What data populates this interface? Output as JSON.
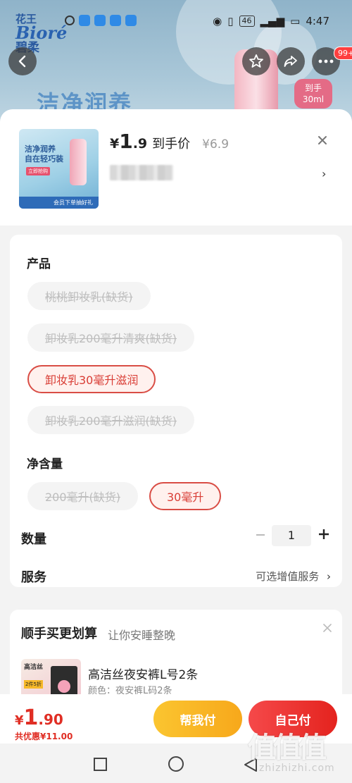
{
  "status_bar": {
    "network": "46",
    "time": "4:47"
  },
  "hero": {
    "brand_cn": "花王",
    "brand_en": "Bioré",
    "brand_cn2": "碧柔",
    "headline": "洁净润养",
    "badge": "到手\n30ml"
  },
  "cart_count": "99+",
  "product": {
    "thumb_title": "洁净润养\n自在轻巧装",
    "thumb_tag": "立即抢购",
    "thumb_footer": "会员下单抽好礼",
    "currency": "¥",
    "price_int": "1",
    "price_dec": ".9",
    "price_label": "到手价",
    "original_price": "¥6.9"
  },
  "options": {
    "product_label": "产品",
    "product_items": [
      {
        "label": "桃桃卸妆乳(缺货)",
        "state": "out_of_stock"
      },
      {
        "label": "卸妆乳200毫升清爽(缺货)",
        "state": "out_of_stock"
      },
      {
        "label": "卸妆乳30毫升滋润",
        "state": "selected"
      },
      {
        "label": "卸妆乳200毫升滋润(缺货)",
        "state": "out_of_stock"
      }
    ],
    "volume_label": "净含量",
    "volume_items": [
      {
        "label": "200毫升(缺货)",
        "state": "out_of_stock"
      },
      {
        "label": "30毫升",
        "state": "selected"
      }
    ]
  },
  "quantity": {
    "label": "数量",
    "value": "1"
  },
  "service": {
    "label": "服务",
    "value": "可选增值服务"
  },
  "recommend": {
    "title": "顺手买更划算",
    "subtitle": "让你安睡整晚",
    "img_logo": "高洁丝",
    "img_badge": "2件5折",
    "item_name": "高洁丝夜安裤L号2条",
    "item_variant": "颜色：夜安裤L码2条"
  },
  "footer": {
    "currency": "¥",
    "total_int": "1",
    "total_dec": ".90",
    "saved": "共优惠¥11.00",
    "help_pay": "帮我付",
    "self_pay": "自己付"
  },
  "watermark": {
    "logo": "值值值",
    "url": "zhizhizhi.com"
  },
  "colors": {
    "accent_red": "#e02e24",
    "help_yellow": "#f7b11f",
    "selected_border": "#d94d45"
  },
  "icons": [
    "back-icon",
    "star-icon",
    "share-icon",
    "more-icon",
    "close-icon",
    "chevron-right-icon",
    "minus-icon",
    "plus-icon",
    "home-square-icon",
    "home-circle-icon",
    "back-triangle-icon"
  ]
}
